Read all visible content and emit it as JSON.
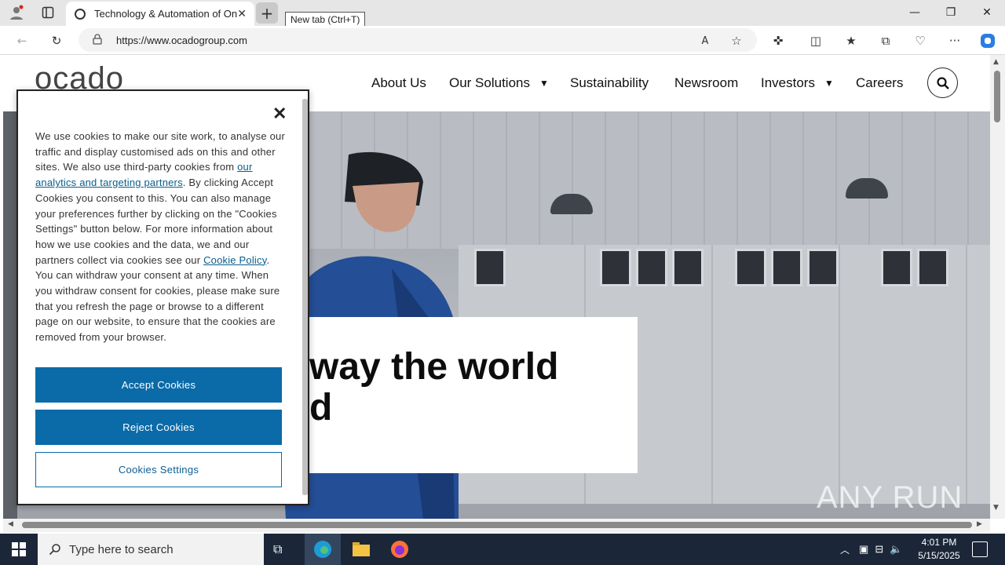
{
  "browser": {
    "tab_title": "Technology & Automation of Onl",
    "tooltip": "New tab (Ctrl+T)",
    "url": "https://www.ocadogroup.com"
  },
  "site": {
    "logo": "ocado",
    "nav": [
      "About Us",
      "Our Solutions",
      "Sustainability",
      "Newsroom",
      "Investors",
      "Careers"
    ],
    "headline_line1": "way the world",
    "headline_line2": "d"
  },
  "cookie": {
    "text_part1": "We use cookies to make our site work, to analyse our traffic and display customised ads on this and other sites. We also use third-party cookies from ",
    "link1": "our analytics and targeting partners",
    "text_part2": ". By clicking Accept Cookies you consent to this. You can also manage your preferences further by clicking on the \"Cookies Settings\" button below. For more information about how we use cookies and the data, we and our partners collect via cookies see our ",
    "link2": "Cookie Policy",
    "text_part3": ". You can withdraw your consent at any time. When you withdraw consent for cookies, please make sure that you refresh the page or browse to a different page on our website, to ensure that the cookies are removed from your browser.",
    "accept": "Accept Cookies",
    "reject": "Reject Cookies",
    "settings": "Cookies Settings"
  },
  "watermark": "ANY RUN",
  "taskbar": {
    "search_placeholder": "Type here to search",
    "time": "4:01 PM",
    "date": "5/15/2025"
  }
}
